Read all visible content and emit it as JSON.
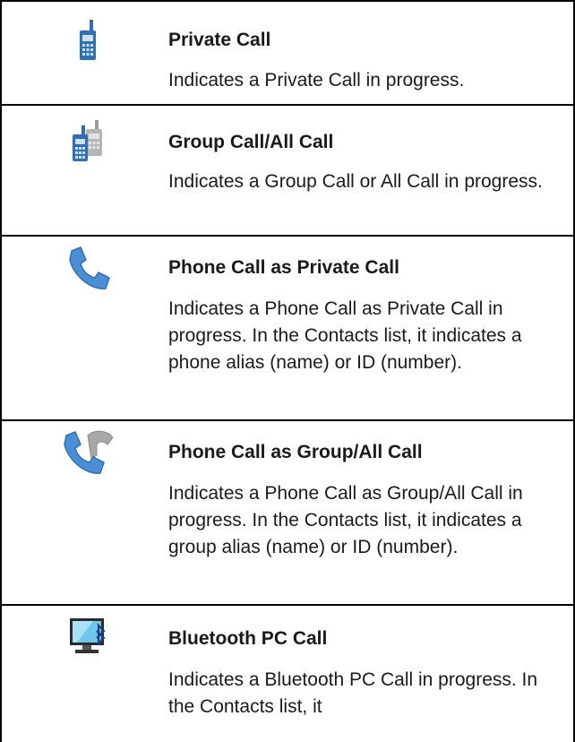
{
  "rows": [
    {
      "icon": "private-call-icon",
      "title": "Private Call",
      "description": "Indicates a Private Call in progress."
    },
    {
      "icon": "group-call-icon",
      "title": "Group Call/All Call",
      "description": "Indicates a Group Call or All Call in progress."
    },
    {
      "icon": "phone-call-private-icon",
      "title": "Phone Call as Private Call",
      "description": "Indicates a Phone Call as Private Call in progress. In the Contacts list, it indicates a phone alias (name) or ID (number)."
    },
    {
      "icon": "phone-call-group-icon",
      "title": "Phone Call as Group/All Call",
      "description": "Indicates a Phone Call as Group/All Call in progress. In the Contacts list, it indicates a group alias (name) or ID (number)."
    },
    {
      "icon": "bluetooth-pc-call-icon",
      "title": "Bluetooth PC Call",
      "description": "Indicates a Bluetooth PC Call in progress. In the Contacts list, it"
    }
  ],
  "colors": {
    "radio_blue": "#2f6fb5",
    "phone_blue": "#4a8fd6",
    "grey": "#9a9a9a",
    "border": "#000000"
  }
}
